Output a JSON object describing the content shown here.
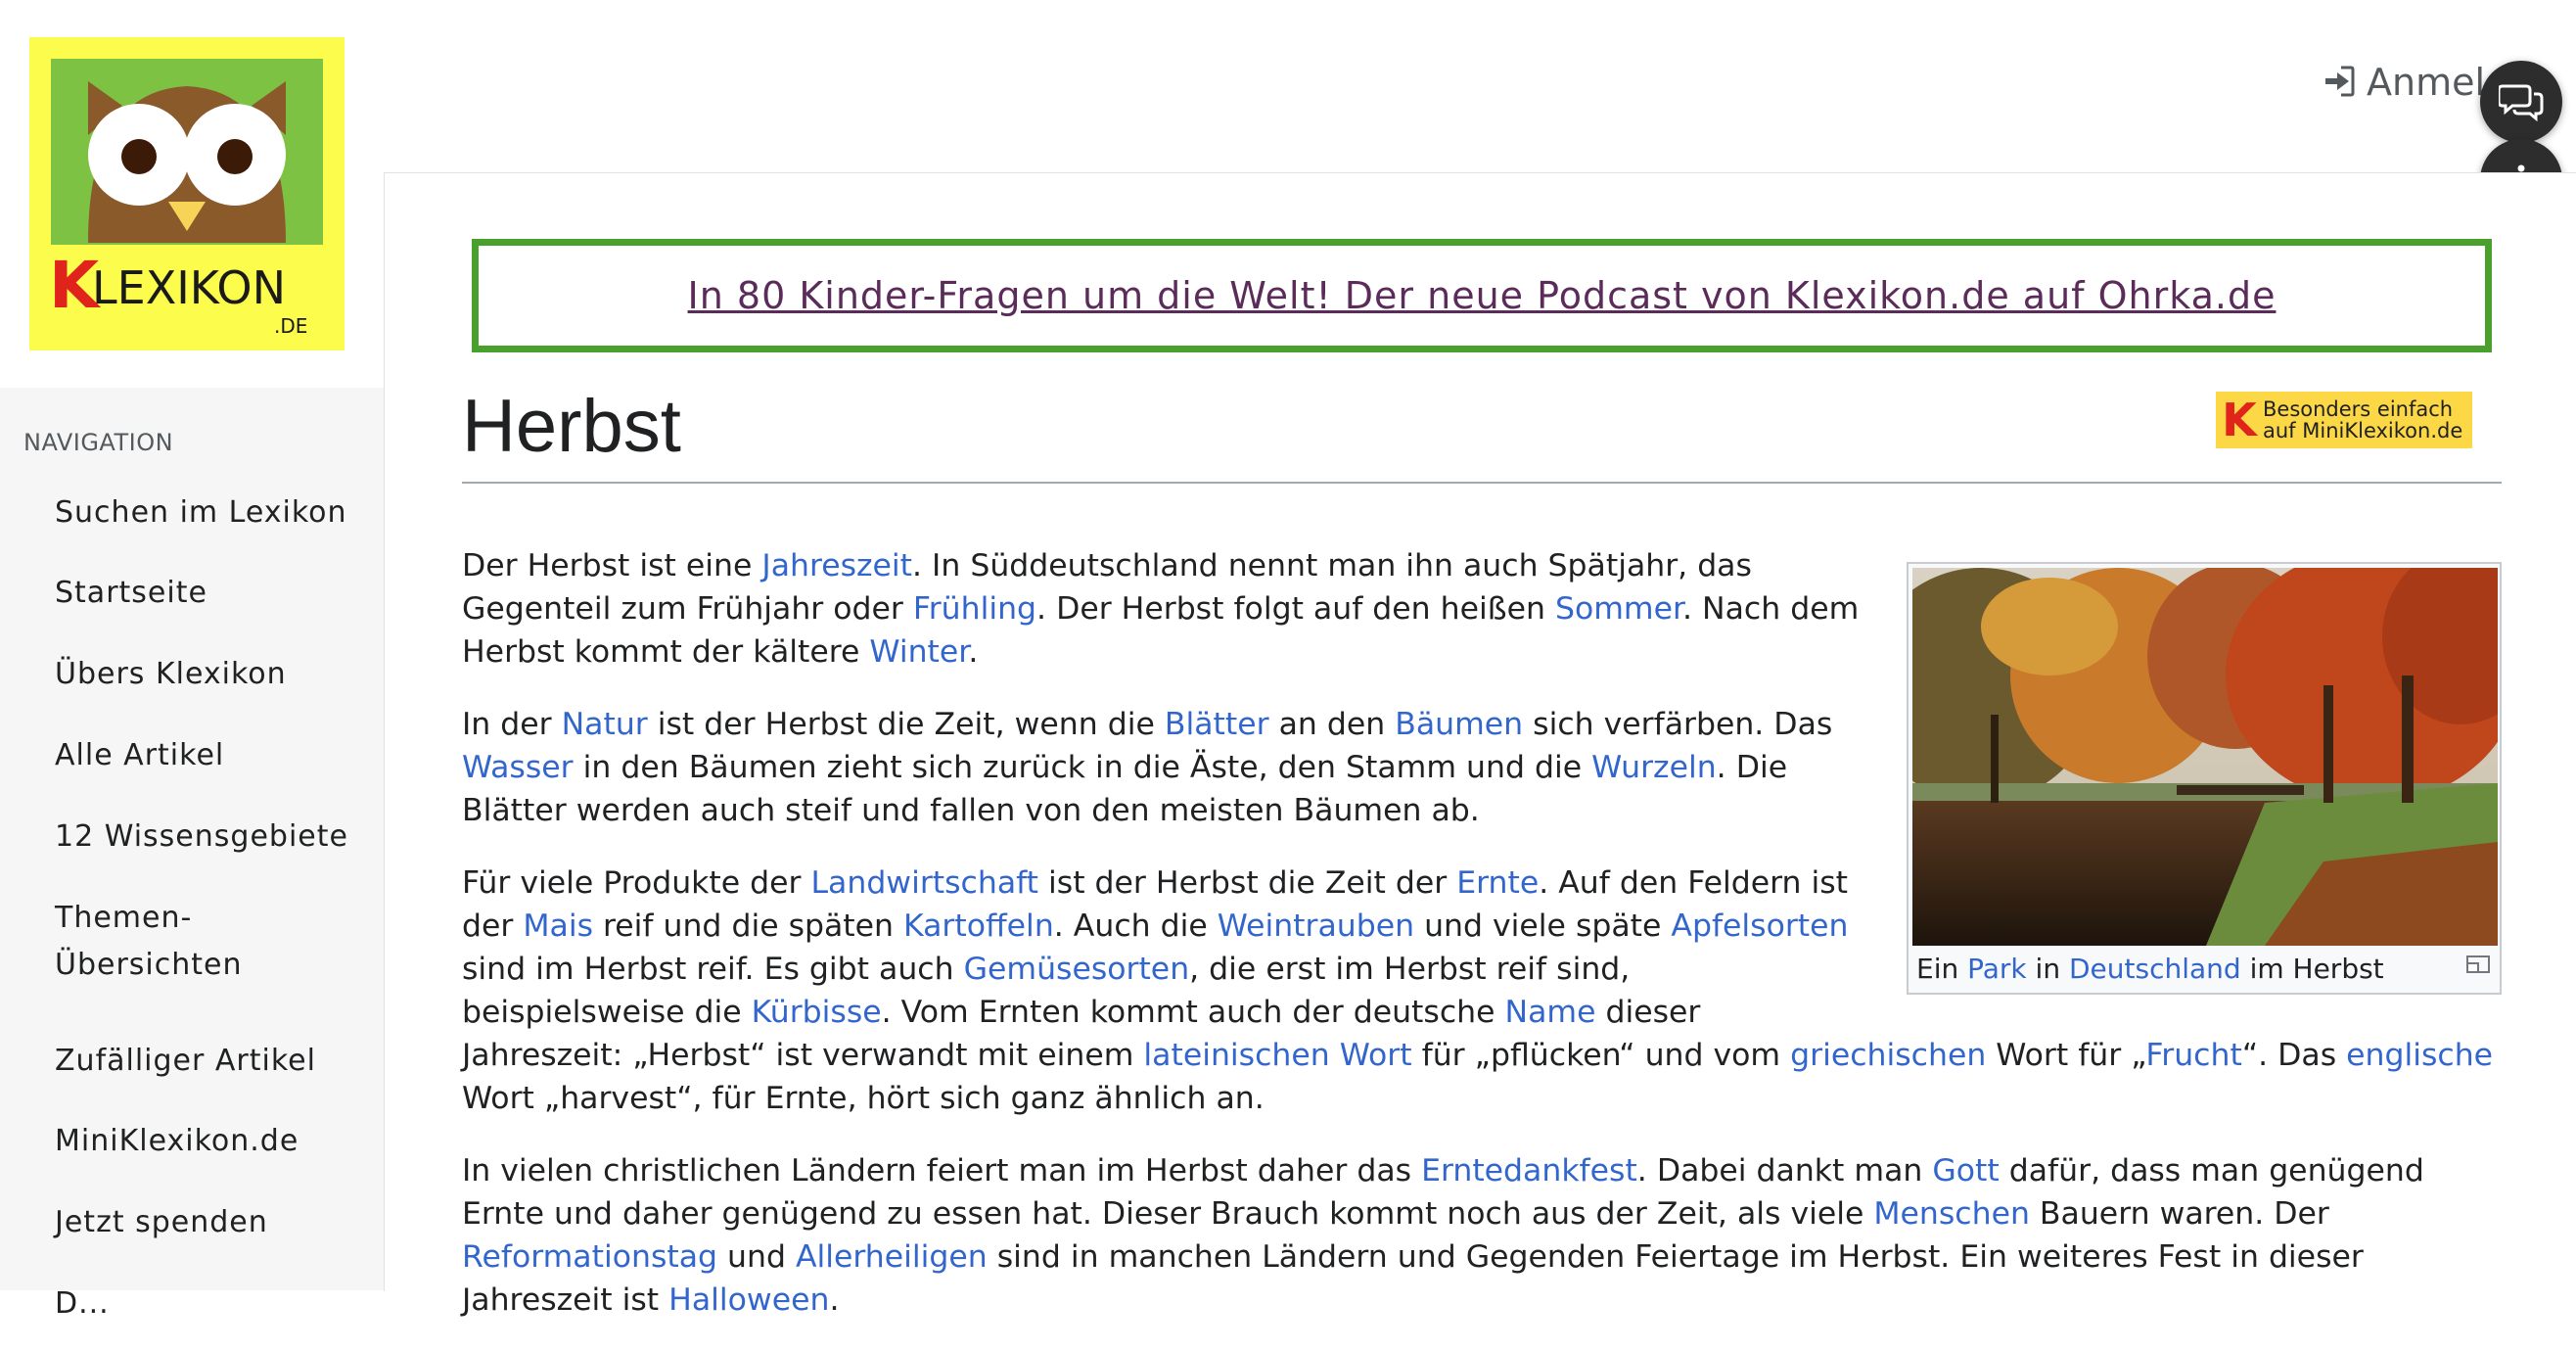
{
  "logo": {
    "text_k": "K",
    "text_rest": "LEXIKON",
    "text_domain": ".DE"
  },
  "navigation": {
    "heading": "NAVIGATION",
    "items": [
      "Suchen im Lexikon",
      "Startseite",
      "Übers Klexikon",
      "Alle Artikel",
      "12 Wissensgebiete",
      "Themen-Übersichten",
      "Zufälliger Artikel",
      "MiniKlexikon.de",
      "Jetzt spenden",
      "D..."
    ]
  },
  "header": {
    "login_label": "Anmelden",
    "login_icon": "sign-in-icon"
  },
  "floating": {
    "chat_icon": "chat-bubbles-icon",
    "more_icon": "vertical-dots-icon"
  },
  "banner": {
    "text": "In 80 Kinder-Fragen um die Welt! Der neue Podcast von Klexikon.de auf Ohrka.de"
  },
  "page": {
    "title": "Herbst"
  },
  "mini_badge": {
    "letter": "K",
    "line1": "Besonders einfach",
    "line2": "auf MiniKlexikon.de"
  },
  "thumbnail": {
    "caption_pre": "Ein ",
    "caption_link1": "Park",
    "caption_mid": " in ",
    "caption_link2": "Deutschland",
    "caption_post": " im Herbst"
  },
  "article": {
    "paragraphs": [
      [
        {
          "t": "Der Herbst ist eine "
        },
        {
          "l": "Jahreszeit"
        },
        {
          "t": ". In Süddeutschland nennt man ihn auch Spätjahr, das Gegenteil zum Frühjahr oder "
        },
        {
          "l": "Frühling"
        },
        {
          "t": ". Der Herbst folgt auf den heißen "
        },
        {
          "l": "Sommer"
        },
        {
          "t": ". Nach dem Herbst kommt der kältere "
        },
        {
          "l": "Winter"
        },
        {
          "t": "."
        }
      ],
      [
        {
          "t": "In der "
        },
        {
          "l": "Natur"
        },
        {
          "t": " ist der Herbst die Zeit, wenn die "
        },
        {
          "l": "Blätter"
        },
        {
          "t": " an den "
        },
        {
          "l": "Bäumen"
        },
        {
          "t": " sich verfärben. Das "
        },
        {
          "l": "Wasser"
        },
        {
          "t": " in den Bäumen zieht sich zurück in die Äste, den Stamm und die "
        },
        {
          "l": "Wurzeln"
        },
        {
          "t": ". Die Blätter werden auch steif und fallen von den meisten Bäumen ab."
        }
      ],
      [
        {
          "t": "Für viele Produkte der "
        },
        {
          "l": "Landwirtschaft"
        },
        {
          "t": " ist der Herbst die Zeit der "
        },
        {
          "l": "Ernte"
        },
        {
          "t": ". Auf den Feldern ist der "
        },
        {
          "l": "Mais"
        },
        {
          "t": " reif und die späten "
        },
        {
          "l": "Kartoffeln"
        },
        {
          "t": ". Auch die "
        },
        {
          "l": "Weintrauben"
        },
        {
          "t": " und viele späte "
        },
        {
          "l": "Apfelsorten"
        },
        {
          "t": " sind im Herbst reif. Es gibt auch "
        },
        {
          "l": "Gemüsesorten"
        },
        {
          "t": ", die erst im Herbst reif sind, beispielsweise die "
        },
        {
          "l": "Kürbisse"
        },
        {
          "t": ". Vom Ernten kommt auch der deutsche "
        },
        {
          "l": "Name"
        },
        {
          "t": " dieser Jahreszeit: „Herbst“ ist verwandt mit einem "
        },
        {
          "l": "lateinischen Wort"
        },
        {
          "t": " für „pflücken“ und vom "
        },
        {
          "l": "griechischen"
        },
        {
          "t": " Wort für „"
        },
        {
          "l": "Frucht"
        },
        {
          "t": "“. Das "
        },
        {
          "l": "englische"
        },
        {
          "t": " Wort „harvest“, für Ernte, hört sich ganz ähnlich an."
        }
      ],
      [
        {
          "t": "In vielen christlichen Ländern feiert man im Herbst daher das "
        },
        {
          "l": "Erntedankfest"
        },
        {
          "t": ". Dabei dankt man "
        },
        {
          "l": "Gott"
        },
        {
          "t": " dafür, dass man genügend Ernte und daher genügend zu essen hat. Dieser Brauch kommt noch aus der Zeit, als viele "
        },
        {
          "l": "Menschen"
        },
        {
          "t": " Bauern waren. Der "
        },
        {
          "l": "Reformationstag"
        },
        {
          "t": " und "
        },
        {
          "l": "Allerheiligen"
        },
        {
          "t": " sind in manchen Ländern und Gegenden Feiertage im Herbst. Ein weiteres Fest in dieser Jahreszeit ist "
        },
        {
          "l": "Halloween"
        },
        {
          "t": "."
        }
      ]
    ]
  },
  "colors": {
    "link": "#3366cc",
    "banner_border": "#4aa02c",
    "banner_text": "#5b2c59",
    "logo_bg": "#fcfc4d",
    "badge_bg": "#fcd846"
  }
}
